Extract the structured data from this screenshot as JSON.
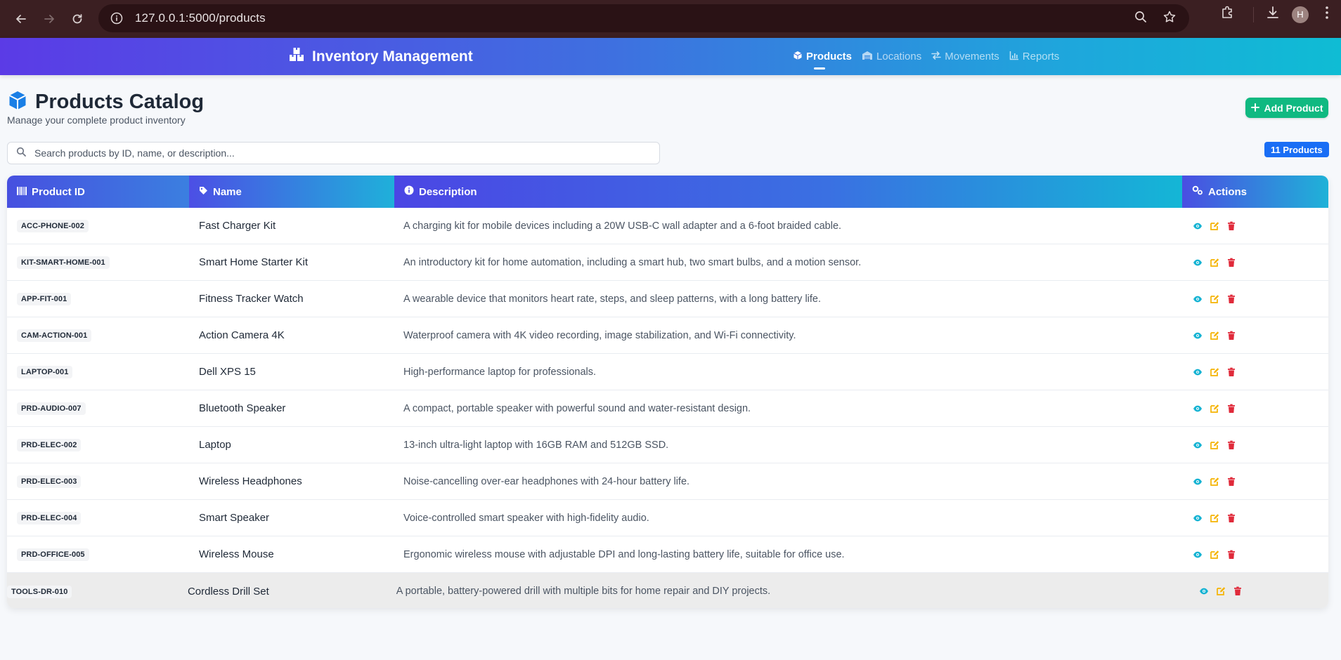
{
  "browser": {
    "url": "127.0.0.1:5000/products",
    "profile_initial": "H"
  },
  "header": {
    "brand": "Inventory Management",
    "nav": [
      {
        "label": "Products",
        "icon": "cube-icon",
        "active": true
      },
      {
        "label": "Locations",
        "icon": "warehouse-icon",
        "active": false
      },
      {
        "label": "Movements",
        "icon": "exchange-icon",
        "active": false
      },
      {
        "label": "Reports",
        "icon": "chart-icon",
        "active": false
      }
    ]
  },
  "page": {
    "title": "Products Catalog",
    "subtitle": "Manage your complete product inventory",
    "add_button": "Add Product",
    "search_placeholder": "Search products by ID, name, or description...",
    "count_badge": "11 Products"
  },
  "table": {
    "headers": [
      "Product ID",
      "Name",
      "Description",
      "Actions"
    ],
    "rows": [
      {
        "id": "ACC-PHONE-002",
        "name": "Fast Charger Kit",
        "description": "A charging kit for mobile devices including a 20W USB-C wall adapter and a 6-foot braided cable."
      },
      {
        "id": "KIT-SMART-HOME-001",
        "name": "Smart Home Starter Kit",
        "description": "An introductory kit for home automation, including a smart hub, two smart bulbs, and a motion sensor."
      },
      {
        "id": "APP-FIT-001",
        "name": "Fitness Tracker Watch",
        "description": "A wearable device that monitors heart rate, steps, and sleep patterns, with a long battery life."
      },
      {
        "id": "CAM-ACTION-001",
        "name": "Action Camera 4K",
        "description": "Waterproof camera with 4K video recording, image stabilization, and Wi-Fi connectivity."
      },
      {
        "id": "LAPTOP-001",
        "name": "Dell XPS 15",
        "description": "High-performance laptop for professionals."
      },
      {
        "id": "PRD-AUDIO-007",
        "name": "Bluetooth Speaker",
        "description": "A compact, portable speaker with powerful sound and water-resistant design."
      },
      {
        "id": "PRD-ELEC-002",
        "name": "Laptop",
        "description": "13-inch ultra-light laptop with 16GB RAM and 512GB SSD."
      },
      {
        "id": "PRD-ELEC-003",
        "name": "Wireless Headphones",
        "description": "Noise-cancelling over-ear headphones with 24-hour battery life."
      },
      {
        "id": "PRD-ELEC-004",
        "name": "Smart Speaker",
        "description": "Voice-controlled smart speaker with high-fidelity audio."
      },
      {
        "id": "PRD-OFFICE-005",
        "name": "Wireless Mouse",
        "description": "Ergonomic wireless mouse with adjustable DPI and long-lasting battery life, suitable for office use."
      },
      {
        "id": "TOOLS-DR-010",
        "name": "Cordless Drill Set",
        "description": "A portable, battery-powered drill with multiple bits for home repair and DIY projects."
      }
    ]
  },
  "colors": {
    "view": "#16b3d3",
    "edit": "#f5b301",
    "delete": "#e02a3a",
    "add_button": "#10b981",
    "badge": "#1a6ef5"
  }
}
